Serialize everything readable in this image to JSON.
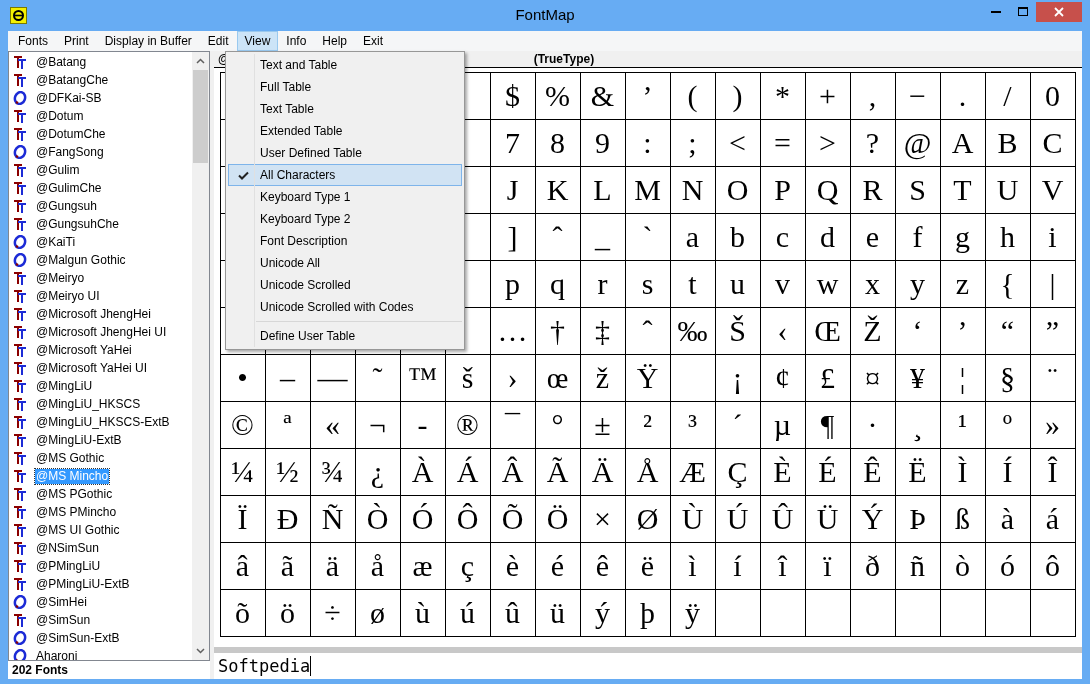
{
  "window": {
    "title": "FontMap"
  },
  "menu": [
    {
      "label": "Fonts",
      "selected": false
    },
    {
      "label": "Print",
      "selected": false
    },
    {
      "label": "Display in Buffer",
      "selected": false
    },
    {
      "label": "Edit",
      "selected": false
    },
    {
      "label": "View",
      "selected": true
    },
    {
      "label": "Info",
      "selected": false
    },
    {
      "label": "Help",
      "selected": false
    },
    {
      "label": "Exit",
      "selected": false
    }
  ],
  "view_menu": {
    "items": [
      {
        "kind": "item",
        "label": "Text and Table",
        "checked": false
      },
      {
        "kind": "item",
        "label": "Full Table",
        "checked": false
      },
      {
        "kind": "item",
        "label": "Text Table",
        "checked": false
      },
      {
        "kind": "item",
        "label": "Extended Table",
        "checked": false
      },
      {
        "kind": "item",
        "label": "User Defined Table",
        "checked": false
      },
      {
        "kind": "item",
        "label": "All Characters",
        "checked": true
      },
      {
        "kind": "item",
        "label": "Keyboard Type 1",
        "checked": false
      },
      {
        "kind": "item",
        "label": "Keyboard Type 2",
        "checked": false
      },
      {
        "kind": "item",
        "label": "Font Description",
        "checked": false
      },
      {
        "kind": "item",
        "label": "Unicode All",
        "checked": false
      },
      {
        "kind": "item",
        "label": "Unicode Scrolled",
        "checked": false
      },
      {
        "kind": "item",
        "label": "Unicode Scrolled with Codes",
        "checked": false
      },
      {
        "kind": "separator"
      },
      {
        "kind": "item",
        "label": "Define User Table",
        "checked": false
      }
    ]
  },
  "font_list": {
    "items": [
      {
        "name": "@Batang",
        "kind": "truetype",
        "selected": false
      },
      {
        "name": "@BatangChe",
        "kind": "truetype",
        "selected": false
      },
      {
        "name": "@DFKai-SB",
        "kind": "opentype",
        "selected": false
      },
      {
        "name": "@Dotum",
        "kind": "truetype",
        "selected": false
      },
      {
        "name": "@DotumChe",
        "kind": "truetype",
        "selected": false
      },
      {
        "name": "@FangSong",
        "kind": "opentype",
        "selected": false
      },
      {
        "name": "@Gulim",
        "kind": "truetype",
        "selected": false
      },
      {
        "name": "@GulimChe",
        "kind": "truetype",
        "selected": false
      },
      {
        "name": "@Gungsuh",
        "kind": "truetype",
        "selected": false
      },
      {
        "name": "@GungsuhChe",
        "kind": "truetype",
        "selected": false
      },
      {
        "name": "@KaiTi",
        "kind": "opentype",
        "selected": false
      },
      {
        "name": "@Malgun Gothic",
        "kind": "opentype",
        "selected": false
      },
      {
        "name": "@Meiryo",
        "kind": "truetype",
        "selected": false
      },
      {
        "name": "@Meiryo UI",
        "kind": "truetype",
        "selected": false
      },
      {
        "name": "@Microsoft JhengHei",
        "kind": "truetype",
        "selected": false
      },
      {
        "name": "@Microsoft JhengHei UI",
        "kind": "truetype",
        "selected": false
      },
      {
        "name": "@Microsoft YaHei",
        "kind": "truetype",
        "selected": false
      },
      {
        "name": "@Microsoft YaHei UI",
        "kind": "truetype",
        "selected": false
      },
      {
        "name": "@MingLiU",
        "kind": "truetype",
        "selected": false
      },
      {
        "name": "@MingLiU_HKSCS",
        "kind": "truetype",
        "selected": false
      },
      {
        "name": "@MingLiU_HKSCS-ExtB",
        "kind": "truetype",
        "selected": false
      },
      {
        "name": "@MingLiU-ExtB",
        "kind": "truetype",
        "selected": false
      },
      {
        "name": "@MS Gothic",
        "kind": "truetype",
        "selected": false
      },
      {
        "name": "@MS Mincho",
        "kind": "truetype",
        "selected": true
      },
      {
        "name": "@MS PGothic",
        "kind": "truetype",
        "selected": false
      },
      {
        "name": "@MS PMincho",
        "kind": "truetype",
        "selected": false
      },
      {
        "name": "@MS UI Gothic",
        "kind": "truetype",
        "selected": false
      },
      {
        "name": "@NSimSun",
        "kind": "truetype",
        "selected": false
      },
      {
        "name": "@PMingLiU",
        "kind": "truetype",
        "selected": false
      },
      {
        "name": "@PMingLiU-ExtB",
        "kind": "truetype",
        "selected": false
      },
      {
        "name": "@SimHei",
        "kind": "opentype",
        "selected": false
      },
      {
        "name": "@SimSun",
        "kind": "truetype",
        "selected": false
      },
      {
        "name": "@SimSun-ExtB",
        "kind": "opentype",
        "selected": false
      },
      {
        "name": "Aharoni",
        "kind": "opentype",
        "selected": false
      }
    ],
    "count": "202 Fonts"
  },
  "table_header": {
    "font": "@",
    "type": "(TrueType)"
  },
  "char_table": {
    "rows": [
      {
        "cells": [
          null,
          null,
          null,
          null,
          null,
          null,
          "$",
          "%",
          "&",
          "’",
          "(",
          ")",
          "*",
          "+",
          ",",
          "−",
          ".",
          "/",
          "0"
        ]
      },
      {
        "cells": [
          null,
          null,
          null,
          null,
          null,
          null,
          "7",
          "8",
          "9",
          ":",
          ";",
          "<",
          "=",
          ">",
          "?",
          "@",
          "A",
          "B",
          "C"
        ]
      },
      {
        "cells": [
          null,
          null,
          null,
          null,
          null,
          null,
          "J",
          "K",
          "L",
          "M",
          "N",
          "O",
          "P",
          "Q",
          "R",
          "S",
          "T",
          "U",
          "V"
        ]
      },
      {
        "cells": [
          null,
          null,
          null,
          null,
          null,
          null,
          "]",
          "ˆ",
          "_",
          "`",
          "a",
          "b",
          "c",
          "d",
          "e",
          "f",
          "g",
          "h",
          "i"
        ]
      },
      {
        "cells": [
          null,
          null,
          null,
          null,
          null,
          null,
          "p",
          "q",
          "r",
          "s",
          "t",
          "u",
          "v",
          "w",
          "x",
          "y",
          "z",
          "{",
          "|"
        ]
      },
      {
        "cells": [
          null,
          null,
          null,
          null,
          null,
          null,
          "…",
          "†",
          "‡",
          "ˆ",
          "‰",
          "Š",
          "‹",
          "Œ",
          "Ž",
          "‘",
          "’",
          "“",
          "”"
        ]
      },
      {
        "cells": [
          "•",
          "–",
          "—",
          "˜",
          "™",
          "š",
          "›",
          "œ",
          "ž",
          "Ÿ",
          null,
          "¡",
          "¢",
          "£",
          "¤",
          "¥",
          "¦",
          "§",
          "¨"
        ]
      },
      {
        "cells": [
          "©",
          "ª",
          "«",
          "¬",
          "-",
          "®",
          "¯",
          "°",
          "±",
          "²",
          "³",
          "´",
          "µ",
          "¶",
          "·",
          "¸",
          "¹",
          "º",
          "»"
        ]
      },
      {
        "cells": [
          "¼",
          "½",
          "¾",
          "¿",
          "À",
          "Á",
          "Â",
          "Ã",
          "Ä",
          "Å",
          "Æ",
          "Ç",
          "È",
          "É",
          "Ê",
          "Ë",
          "Ì",
          "Í",
          "Î"
        ]
      },
      {
        "cells": [
          "Ï",
          "Ð",
          "Ñ",
          "Ò",
          "Ó",
          "Ô",
          "Õ",
          "Ö",
          "×",
          "Ø",
          "Ù",
          "Ú",
          "Û",
          "Ü",
          "Ý",
          "Þ",
          "ß",
          "à",
          "á"
        ]
      },
      {
        "cells": [
          "â",
          "ã",
          "ä",
          "å",
          "æ",
          "ç",
          "è",
          "é",
          "ê",
          "ë",
          "ì",
          "í",
          "î",
          "ï",
          "ð",
          "ñ",
          "ò",
          "ó",
          "ô"
        ]
      },
      {
        "cells": [
          "õ",
          "ö",
          "÷",
          "ø",
          "ù",
          "ú",
          "û",
          "ü",
          "ý",
          "þ",
          "ÿ"
        ]
      }
    ]
  },
  "buffer": {
    "value": "Softpedia"
  }
}
